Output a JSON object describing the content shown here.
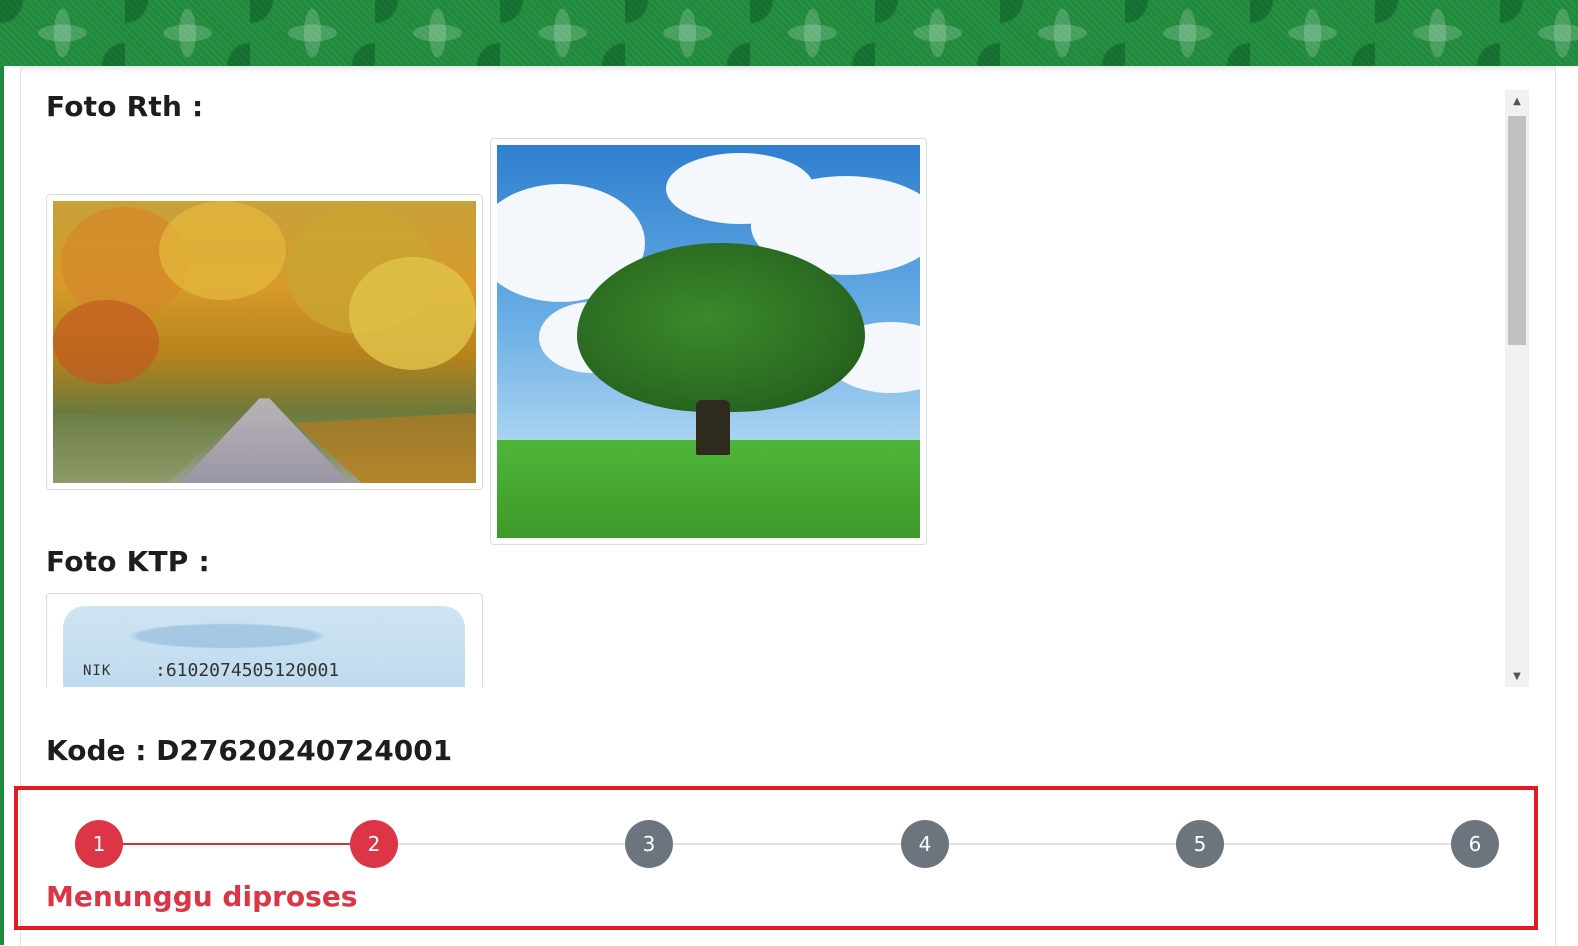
{
  "sections": {
    "foto_rth_title": "Foto Rth :",
    "foto_ktp_title": "Foto KTP :"
  },
  "ktp": {
    "nik_label": "NIK",
    "nik_value": ":6102074505120001"
  },
  "kode": "Kode : D27620240724001",
  "progress": {
    "steps": [
      "1",
      "2",
      "3",
      "4",
      "5",
      "6"
    ],
    "current_step": 2,
    "status": "Menunggu diproses"
  },
  "colors": {
    "banner_green": "#1f8a3c",
    "step_done": "#dc3545",
    "step_todo": "#6c757d",
    "highlight_border": "#e01b22"
  },
  "icons": {
    "scroll_up": "▲",
    "scroll_down": "▼"
  }
}
